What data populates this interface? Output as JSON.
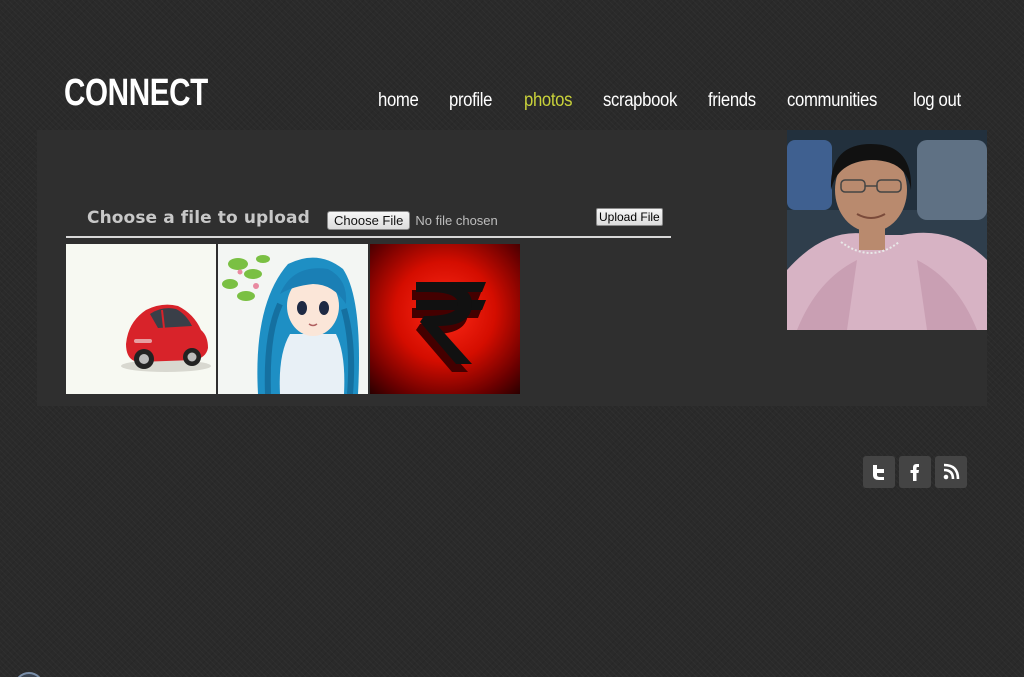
{
  "header": {
    "logo": "CONNECT"
  },
  "nav": {
    "items": [
      {
        "label": "home",
        "active": false
      },
      {
        "label": "profile",
        "active": false
      },
      {
        "label": "photos",
        "active": true
      },
      {
        "label": "scrapbook",
        "active": false
      },
      {
        "label": "friends",
        "active": false
      },
      {
        "label": "communities",
        "active": false
      },
      {
        "label": "log out",
        "active": false
      }
    ],
    "active_color": "#c9d23a"
  },
  "upload": {
    "label": "Choose a file to upload",
    "choose_button": "Choose File",
    "file_status": "No file chosen",
    "upload_button": "Upload File"
  },
  "photos": [
    {
      "name": "car-photo",
      "icon": "red-car"
    },
    {
      "name": "anime-girl-photo",
      "icon": "anime-girl"
    },
    {
      "name": "rupee-symbol-photo",
      "icon": "rupee-symbol",
      "symbol": "₹"
    }
  ],
  "profile_photo": {
    "icon": "profile-portrait"
  },
  "social": {
    "items": [
      {
        "name": "twitter",
        "icon": "twitter-icon"
      },
      {
        "name": "facebook",
        "icon": "facebook-icon"
      },
      {
        "name": "rss",
        "icon": "rss-icon"
      }
    ]
  }
}
